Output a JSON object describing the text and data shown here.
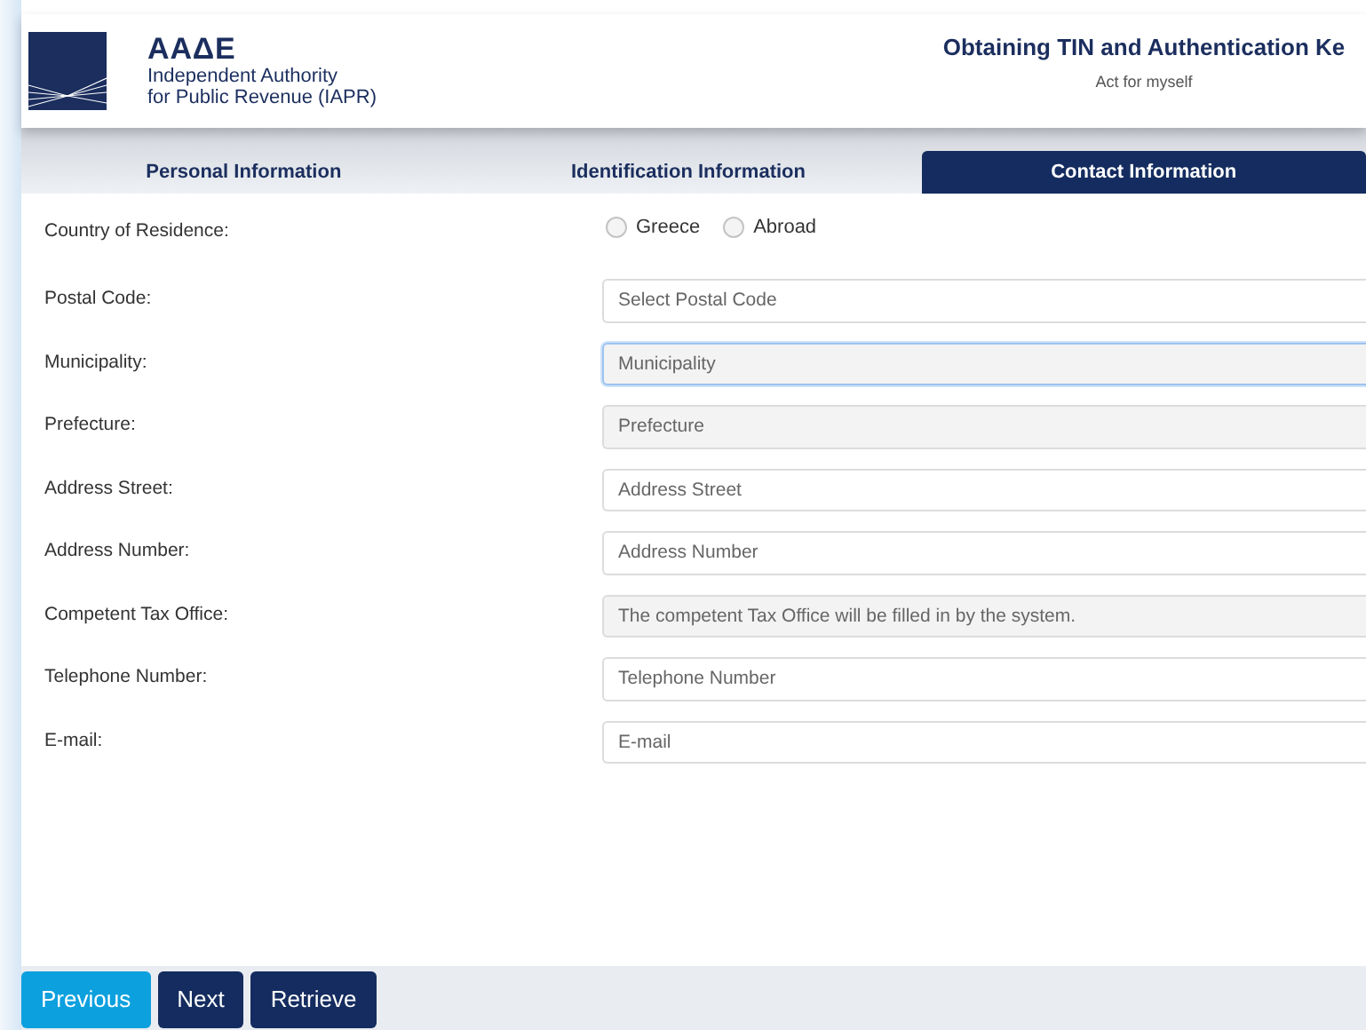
{
  "header": {
    "logo_title": "ΑΑΔΕ",
    "logo_subtitle_1": "Independent Authority",
    "logo_subtitle_2": "for Public Revenue (IAPR)",
    "title": "Obtaining TIN and Authentication Ke",
    "subtitle": "Act for myself"
  },
  "tabs": [
    {
      "label": "Personal Information",
      "selected": false
    },
    {
      "label": "Identification Information",
      "selected": false
    },
    {
      "label": "Contact Information",
      "selected": true
    }
  ],
  "fields": [
    {
      "kind": "radio",
      "label": "Country of Residence:",
      "options": [
        {
          "label": "Greece",
          "selected": false
        },
        {
          "label": "Abroad",
          "selected": false
        }
      ]
    },
    {
      "kind": "input",
      "label": "Postal Code:",
      "placeholder": "Select Postal Code",
      "disabled": false,
      "focused": false
    },
    {
      "kind": "input",
      "label": "Municipality:",
      "placeholder": "Municipality",
      "disabled": true,
      "focused": true
    },
    {
      "kind": "input",
      "label": "Prefecture:",
      "placeholder": "Prefecture",
      "disabled": true,
      "focused": false
    },
    {
      "kind": "input",
      "label": "Address Street:",
      "placeholder": "Address Street",
      "disabled": false,
      "focused": false
    },
    {
      "kind": "input",
      "label": "Address Number:",
      "placeholder": "Address Number",
      "disabled": false,
      "focused": false
    },
    {
      "kind": "input",
      "label": "Competent Tax Office:",
      "placeholder": "The competent Tax Office will be filled in by the system.",
      "disabled": true,
      "focused": false
    },
    {
      "kind": "input",
      "label": "Telephone Number:",
      "placeholder": "Telephone Number",
      "disabled": false,
      "focused": false
    },
    {
      "kind": "input",
      "label": "E-mail:",
      "placeholder": "E-mail",
      "disabled": false,
      "focused": false
    }
  ],
  "buttons": [
    {
      "label": "Previous",
      "kind": "secondary"
    },
    {
      "label": "Next",
      "kind": "primary"
    },
    {
      "label": "Retrieve",
      "kind": "primary"
    }
  ]
}
